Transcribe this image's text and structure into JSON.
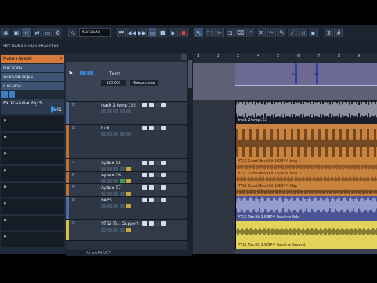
{
  "toolbar": {
    "mode_select": "Касание",
    "buttons": [
      "activate",
      "constrain",
      "auto",
      "loop",
      "rewind",
      "forward",
      "cycle",
      "play",
      "record",
      "arrow",
      "range",
      "split",
      "glue",
      "erase",
      "zoom",
      "mute",
      "time",
      "draw",
      "line",
      "play-tool",
      "color",
      "grid",
      "snap",
      "quantize"
    ]
  },
  "infoline": {
    "text": "Нет выбранных объектов"
  },
  "inspector": {
    "head": "Канал Аудио",
    "sections": [
      "Инсерты",
      "Эквалайзеры",
      "Посылы"
    ],
    "active_slot": {
      "name": "FX 10-Guitar Rig 5",
      "value": "1.21"
    },
    "empty_slots": 9
  },
  "tempo_track": {
    "label": "Темп",
    "value": "120.000",
    "mode": "Фиксирован"
  },
  "tracks": [
    {
      "num": "11",
      "name": "track 2 temp132",
      "color": "#4a6ea0",
      "event_label": "track 2 temp132"
    },
    {
      "num": "12",
      "name": "kick",
      "color": "#c07030",
      "event_label": ""
    },
    {
      "num": "13",
      "name": "Аудио 05",
      "color": "#c07030",
      "event_label": "VTS2 Good Mood Kit 132BPM Loop 1"
    },
    {
      "num": "14",
      "name": "Аудио 06",
      "color": "#c07030",
      "event_label": "VTS2 Good Mood Kit 132BPM Loop 2"
    },
    {
      "num": "15",
      "name": "Аудио 07",
      "color": "#c07030",
      "event_label": "VTS2 Good Mood Kit 132BPM Clap"
    },
    {
      "num": "16",
      "name": "BASS",
      "color": "#4a6ea0",
      "event_label": "VTS2 Tdn Kit 132BPM Bassline Pulv"
    },
    {
      "num": "17",
      "name": "VTS2 Ts... Support",
      "color": "#d8c040",
      "event_label": "VTS2 Tdn Kit 132BPM Bassline Support"
    }
  ],
  "footer_track": "Канал FX/VSTi",
  "ruler": [
    "1",
    "2",
    "3",
    "4",
    "5",
    "6",
    "7",
    "8",
    "9"
  ],
  "tempo_markers": [
    "100",
    "140"
  ]
}
